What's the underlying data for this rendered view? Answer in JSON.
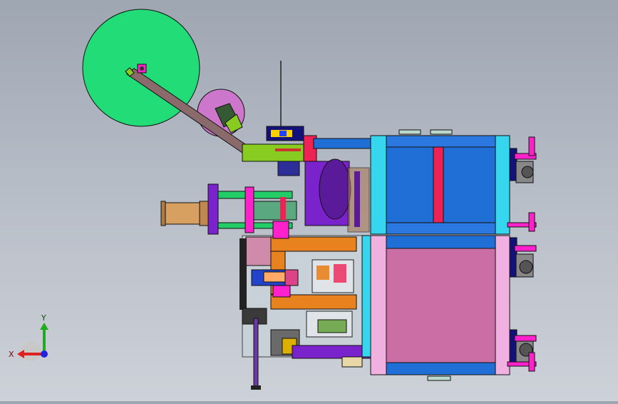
{
  "view": {
    "type": "cad-3d-viewport",
    "background_top": "#9ea6b2",
    "background_bottom": "#cdd1d8"
  },
  "model": {
    "palette": {
      "reel_large": "#22dd77",
      "reel_small": "#cc77cc",
      "frame_blue": "#1f6fd6",
      "frame_cyan": "#36d6ee",
      "frame_pink": "#cc6ea6",
      "accent_red": "#ee2255",
      "orange": "#e8821e",
      "purple": "#7a22cc",
      "cylinder_brass": "#d8a060",
      "lime": "#88cc22",
      "magenta": "#ff22cc",
      "dark_blue": "#12127a"
    }
  },
  "triad": {
    "x_label": "X",
    "y_label": "Y",
    "x_color": "#dd2222",
    "y_color": "#22aa22",
    "z_color": "#2222dd"
  }
}
